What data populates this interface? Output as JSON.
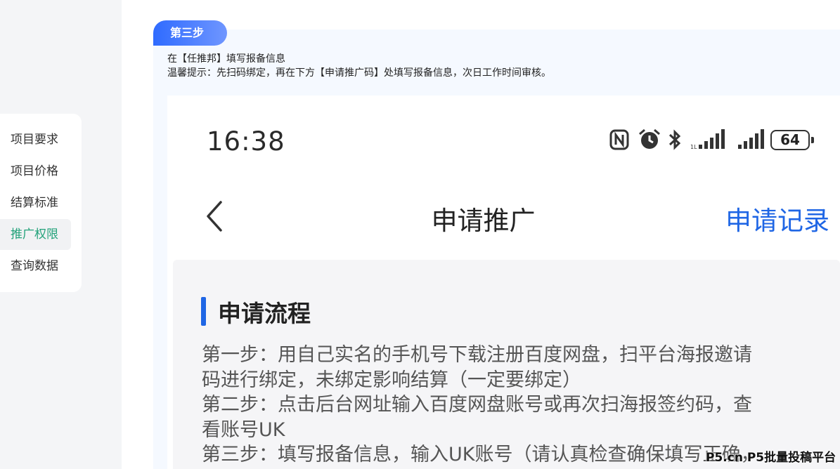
{
  "sidebar": {
    "items": [
      {
        "label": "项目要求"
      },
      {
        "label": "项目价格"
      },
      {
        "label": "结算标准"
      },
      {
        "label": "推广权限",
        "active": true
      },
      {
        "label": "查询数据"
      }
    ],
    "active_color": "#23a27a"
  },
  "step": {
    "badge": "第三步",
    "line1": "在【任推邦】填写报备信息",
    "line2": "温馨提示：先扫码绑定，再在下方【申请推广码】处填写报备信息，次日工作时间审核。"
  },
  "phone": {
    "status": {
      "time": "16:38",
      "icons": [
        "nfc-icon",
        "alarm-icon",
        "bluetooth-icon",
        "signal-icon",
        "signal-icon"
      ],
      "battery": "64"
    },
    "header": {
      "back_icon": "chevron-left-icon",
      "title": "申请推广",
      "right_link": "申请记录"
    },
    "section": {
      "title": "申请流程",
      "lines": [
        "第一步：用自己实名的手机号下载注册百度网盘，扫平台海报邀请",
        "码进行绑定，未绑定影响结算（一定要绑定）",
        "第二步：点击后台网址输入百度网盘账号或再次扫海报签约码，查",
        "看账号UK",
        "第三步：填写报备信息，输入UK账号（请认真检查确保填写正确，"
      ]
    },
    "accent_color": "#1f66e5"
  },
  "watermark": "P5.cn P5批量投稿平台"
}
